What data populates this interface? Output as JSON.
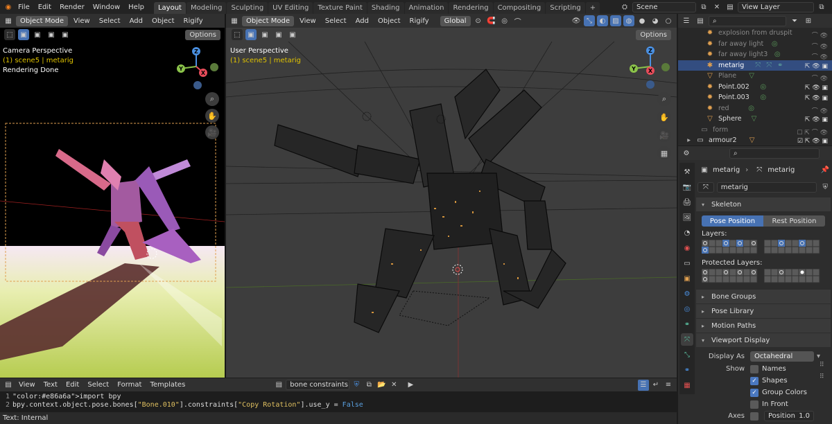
{
  "menubar": {
    "items": [
      "File",
      "Edit",
      "Render",
      "Window",
      "Help"
    ],
    "workspaces": [
      "Layout",
      "Modeling",
      "Sculpting",
      "UV Editing",
      "Texture Paint",
      "Shading",
      "Animation",
      "Rendering",
      "Compositing",
      "Scripting"
    ],
    "active_workspace": "Layout",
    "add_tab": "+",
    "scene": "Scene",
    "view_layer": "View Layer"
  },
  "left_viewport": {
    "mode": "Object Mode",
    "menus": [
      "View",
      "Select",
      "Add",
      "Object",
      "Rigify"
    ],
    "options": "Options",
    "perspective": "Camera Perspective",
    "context": "(1) scene5 | metarig",
    "status": "Rendering Done"
  },
  "main_viewport": {
    "mode": "Object Mode",
    "menus": [
      "View",
      "Select",
      "Add",
      "Object",
      "Rigify"
    ],
    "orientation": "Global",
    "options": "Options",
    "perspective": "User Perspective",
    "context": "(1) scene5 | metarig"
  },
  "gizmo": {
    "x": "X",
    "y": "Y",
    "z": "Z"
  },
  "outliner": {
    "rows": [
      {
        "name": "explosion from druspit",
        "dim": true,
        "selected": false
      },
      {
        "name": "far away light",
        "dim": true,
        "selected": false
      },
      {
        "name": "far away light3",
        "dim": true,
        "selected": false
      },
      {
        "name": "metarig",
        "dim": false,
        "selected": true
      },
      {
        "name": "Plane",
        "dim": true,
        "selected": false
      },
      {
        "name": "Point.002",
        "dim": false,
        "selected": false
      },
      {
        "name": "Point.003",
        "dim": false,
        "selected": false
      },
      {
        "name": "red",
        "dim": true,
        "selected": false
      },
      {
        "name": "Sphere",
        "dim": false,
        "selected": false
      },
      {
        "name": "form",
        "dim": true,
        "selected": false
      },
      {
        "name": "armour2",
        "dim": false,
        "selected": false
      }
    ]
  },
  "properties": {
    "breadcrumb_object": "metarig",
    "breadcrumb_data": "metarig",
    "data_name": "metarig",
    "skeleton": {
      "title": "Skeleton",
      "pose_position": "Pose Position",
      "rest_position": "Rest Position",
      "layers_label": "Layers:",
      "protected_layers_label": "Protected Layers:"
    },
    "panels": [
      "Bone Groups",
      "Pose Library",
      "Motion Paths"
    ],
    "viewport_display": {
      "title": "Viewport Display",
      "display_as_label": "Display As",
      "display_as_value": "Octahedral",
      "show_label": "Show",
      "names": "Names",
      "shapes": "Shapes",
      "group_colors": "Group Colors",
      "in_front": "In Front",
      "axes": "Axes",
      "position_label": "Position",
      "position_value": "1.0",
      "names_checked": false,
      "shapes_checked": true,
      "group_colors_checked": true,
      "in_front_checked": false
    }
  },
  "text_editor": {
    "menus": [
      "View",
      "Text",
      "Edit",
      "Select",
      "Format",
      "Templates"
    ],
    "file_name": "bone constraints",
    "lines": [
      {
        "num": "1",
        "code": "import bpy"
      },
      {
        "num": "2",
        "code": "bpy.context.object.pose.bones[\"Bone.010\"].constraints[\"Copy Rotation\"].use_y = False"
      }
    ],
    "status": "Text: Internal"
  },
  "colors": {
    "accent": "#4772b3",
    "selected_row": "#334d80",
    "yellow_text": "#e0c300",
    "gizmo_x": "#e84c5a",
    "gizmo_y": "#8bc34a",
    "gizmo_z": "#4a90e2"
  }
}
